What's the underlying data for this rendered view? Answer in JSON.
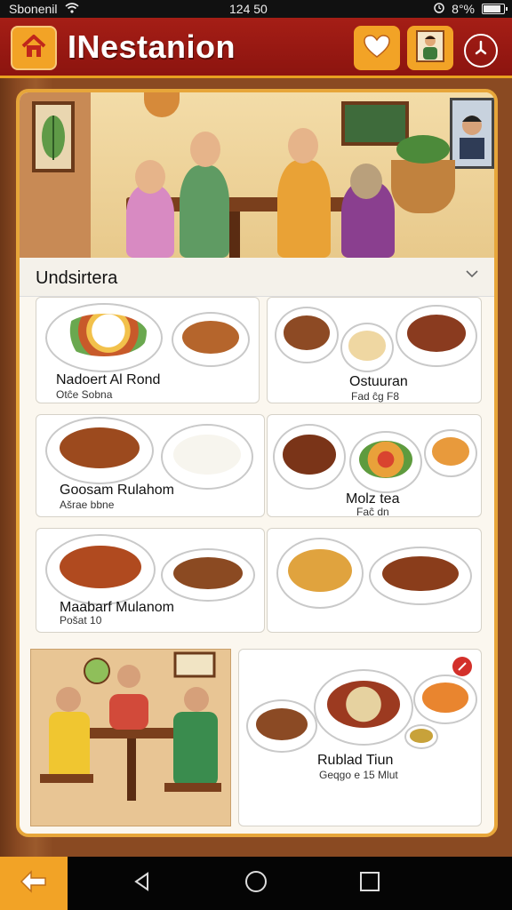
{
  "status": {
    "carrier": "Sbonenil",
    "time": "124 50",
    "battery": "8°%"
  },
  "appbar": {
    "title": "INestanion",
    "icons": [
      "home-icon",
      "heart-icon",
      "profile-icon",
      "close-icon"
    ]
  },
  "section": {
    "title": "Undsirtera"
  },
  "cards": [
    {
      "name": "Nadoert Al Rond",
      "sub": "Otĉe Sobna"
    },
    {
      "name": "Ostuuran",
      "sub": "Fad ĉg F8"
    },
    {
      "name": "Goosam Rulahom",
      "sub": "Ašrae bbne"
    },
    {
      "name": "Molz tea",
      "sub": "Faĉ dn"
    },
    {
      "name": "Maabarf Mulanom",
      "sub": "Pošat 10"
    },
    {
      "name": "Rublad Tiun",
      "sub": "Geqgo e 15 Mlut"
    }
  ],
  "colors": {
    "appbar": "#9c1a13",
    "accent": "#f2a326",
    "panel_border": "#e7a63a"
  }
}
